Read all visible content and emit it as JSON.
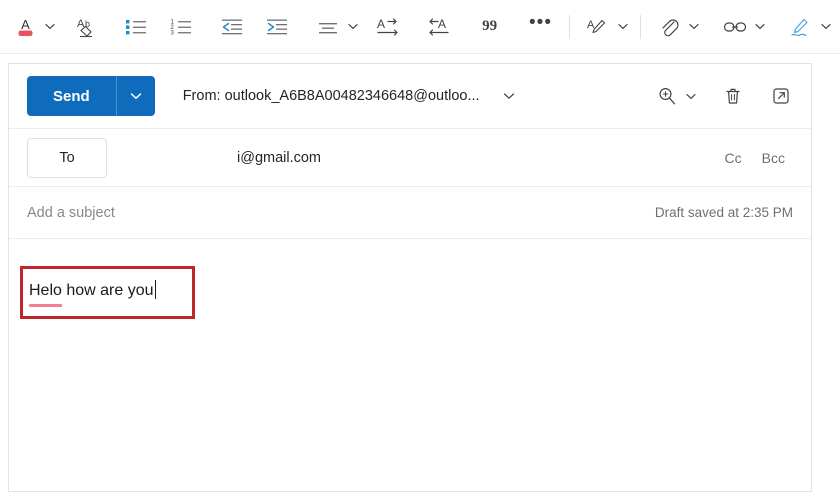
{
  "toolbar": {
    "items": [
      {
        "name": "font-color-icon",
        "label": "Font color",
        "has_chevron": true
      },
      {
        "name": "clear-formatting-icon",
        "label": "Clear formatting",
        "has_chevron": false
      },
      {
        "name": "bulleted-list-icon",
        "label": "Bulleted list",
        "has_chevron": false
      },
      {
        "name": "numbered-list-icon",
        "label": "Numbered list",
        "has_chevron": false
      },
      {
        "name": "decrease-indent-icon",
        "label": "Decrease indent",
        "has_chevron": false
      },
      {
        "name": "increase-indent-icon",
        "label": "Increase indent",
        "has_chevron": false
      },
      {
        "name": "align-icon",
        "label": "Align",
        "has_chevron": true
      },
      {
        "name": "text-direction-ltr-icon",
        "label": "Left-to-right",
        "has_chevron": false
      },
      {
        "name": "text-direction-rtl-icon",
        "label": "Right-to-left",
        "has_chevron": false
      },
      {
        "name": "quote-icon",
        "label": "99",
        "has_chevron": false
      },
      {
        "name": "more-options-icon",
        "label": "More options",
        "has_chevron": false
      },
      {
        "name": "dictate-icon",
        "label": "Dictate",
        "has_chevron": true
      },
      {
        "name": "attach-icon",
        "label": "Attach file",
        "has_chevron": true
      },
      {
        "name": "link-icon",
        "label": "Insert link",
        "has_chevron": true
      },
      {
        "name": "signature-icon",
        "label": "Signature",
        "has_chevron": true
      }
    ],
    "quote_label": "99",
    "more_label": "•••"
  },
  "compose": {
    "send": {
      "label": "Send",
      "dropdown_name": "send-options-chevron"
    },
    "from": {
      "text": "From: outlook_A6B8A00482346648@outloo...",
      "chevron_name": "from-chevron-icon"
    },
    "header_actions": [
      {
        "name": "zoom-icon",
        "label": "Zoom"
      },
      {
        "name": "discard-icon",
        "label": "Discard"
      },
      {
        "name": "popout-icon",
        "label": "Open in new window"
      }
    ],
    "to": {
      "button_label": "To",
      "value": "i@gmail.com",
      "cc_label": "Cc",
      "bcc_label": "Bcc"
    },
    "subject": {
      "placeholder": "Add a subject",
      "draft_status": "Draft saved at 2:35 PM"
    },
    "body": {
      "misspelled_word": "Helo",
      "rest_text": " how are you"
    }
  },
  "colors": {
    "send_blue": "#0f6cbd",
    "annotation_red": "#c0272d",
    "spellcheck_underline": "#f08090",
    "icon_accent_blue": "#1a8cc8",
    "font_color_swatch": "#e8555f"
  }
}
